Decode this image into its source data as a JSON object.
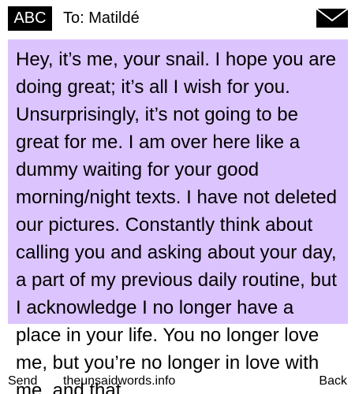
{
  "header": {
    "mode_label": "ABC",
    "recipient": "To: Matildé",
    "mail_icon": "envelope-icon"
  },
  "message": {
    "text": "Hey, it’s me, your snail. I hope you are doing great; it’s all I wish for you. Unsurprisingly, it’s not going to be great for me. I am over here like a dummy waiting for your good morning/night texts. I have not deleted our pictures. Constantly think about calling you and asking about your day, a part of my previous daily routine, but I acknowledge I no longer have a place in your life. You no longer love me, but you’re no longer in love with me, and that"
  },
  "footer": {
    "left_label": "Send",
    "site_label": "theunsaidwords.info",
    "right_label": "Back"
  },
  "colors": {
    "message_background": "#dcc4ff",
    "badge_background": "#000000"
  }
}
